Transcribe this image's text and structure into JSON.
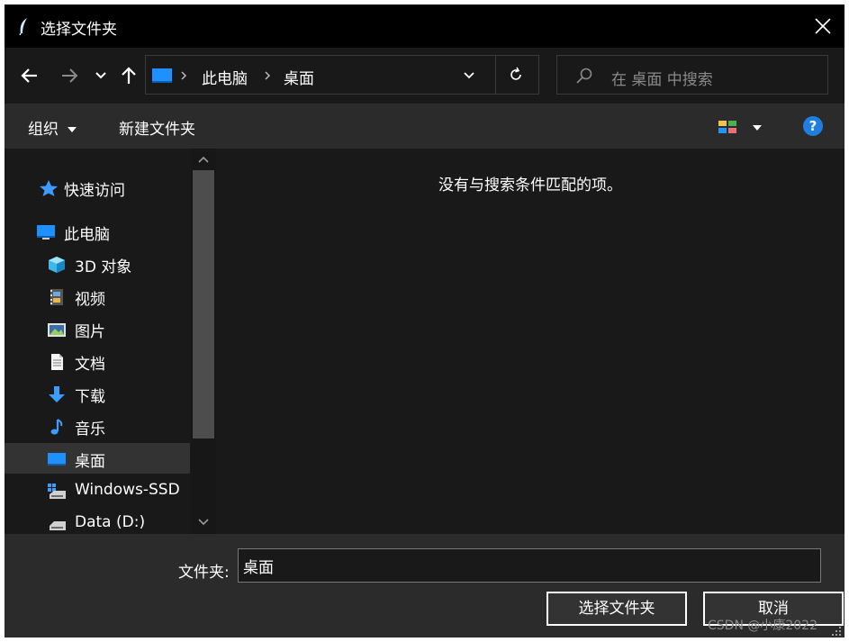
{
  "window": {
    "title": "选择文件夹",
    "close_icon": "close-icon"
  },
  "nav": {
    "back_icon": "arrow-left-icon",
    "forward_icon": "arrow-right-icon",
    "recent_icon": "chevron-down-icon",
    "up_icon": "arrow-up-icon",
    "breadcrumb": [
      "此电脑",
      "桌面"
    ],
    "refresh_icon": "refresh-icon",
    "search_placeholder": "在 桌面 中搜索"
  },
  "toolbar": {
    "organize_label": "组织",
    "new_folder_label": "新建文件夹",
    "help_label": "?"
  },
  "sidebar": {
    "items": [
      {
        "label": "快速访问",
        "icon": "star-icon"
      },
      {
        "label": "此电脑",
        "icon": "computer-icon"
      },
      {
        "label": "3D 对象",
        "icon": "cube-icon"
      },
      {
        "label": "视频",
        "icon": "film-icon"
      },
      {
        "label": "图片",
        "icon": "picture-icon"
      },
      {
        "label": "文档",
        "icon": "document-icon"
      },
      {
        "label": "下载",
        "icon": "download-icon"
      },
      {
        "label": "音乐",
        "icon": "music-icon"
      },
      {
        "label": "桌面",
        "icon": "desktop-icon",
        "selected": true
      },
      {
        "label": "Windows-SSD",
        "icon": "drive-icon"
      },
      {
        "label": "Data (D:)",
        "icon": "drive-icon"
      }
    ]
  },
  "main": {
    "empty_message": "没有与搜索条件匹配的项。"
  },
  "bottom": {
    "folder_label": "文件夹:",
    "folder_value": "桌面",
    "select_button": "选择文件夹",
    "cancel_button": "取消"
  },
  "watermark": "CSDN @小康2022",
  "colors": {
    "accent": "#1e90ff",
    "background": "#191919",
    "titlebar": "#000000",
    "panel": "#2b2b2b"
  }
}
